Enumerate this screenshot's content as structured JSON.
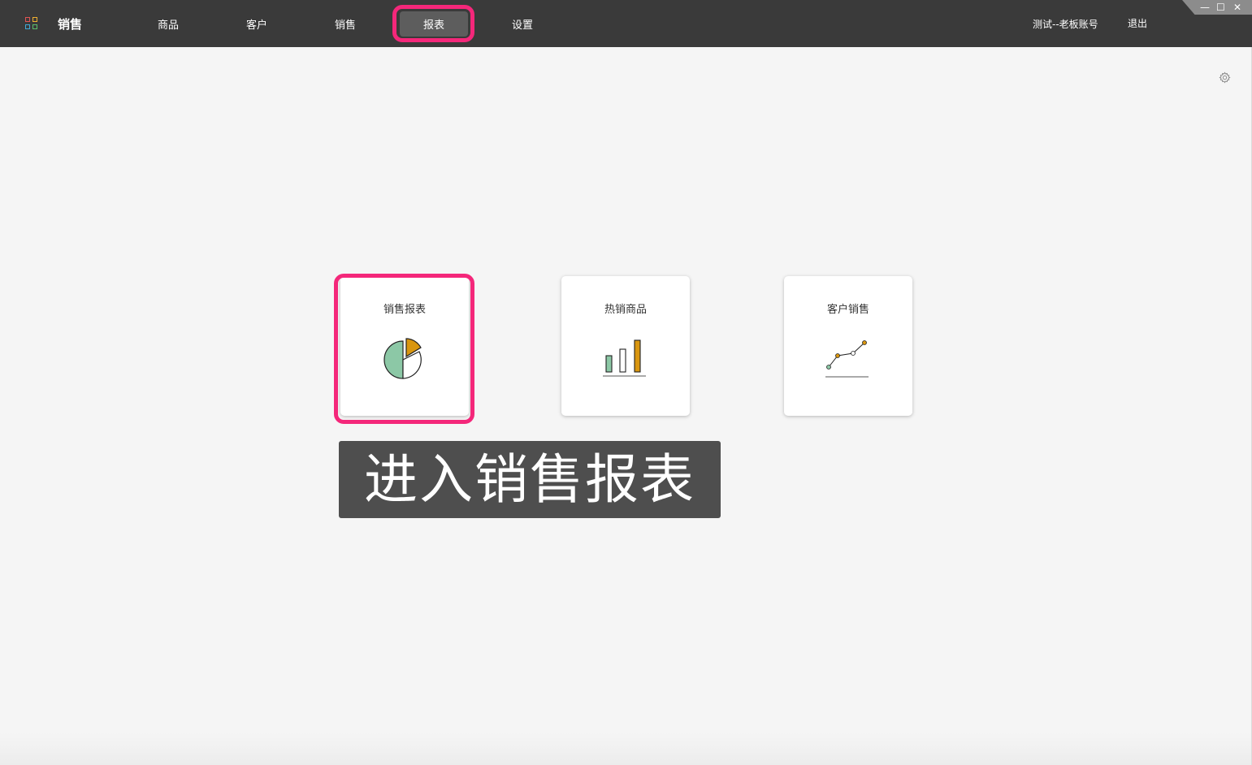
{
  "topbar": {
    "app_title": "销售",
    "nav": [
      {
        "label": "商品"
      },
      {
        "label": "客户"
      },
      {
        "label": "销售"
      },
      {
        "label": "报表",
        "active": true
      },
      {
        "label": "设置"
      }
    ],
    "account": "测试--老板账号",
    "logout": "退出",
    "window_controls": [
      "—",
      "☐",
      "✕"
    ]
  },
  "reports": {
    "cards": [
      {
        "label": "销售报表",
        "icon": "pie-chart-icon",
        "highlighted": true
      },
      {
        "label": "热销商品",
        "icon": "bar-chart-icon"
      },
      {
        "label": "客户销售",
        "icon": "line-chart-icon"
      }
    ]
  },
  "caption": "进入销售报表",
  "colors": {
    "topbar": "#3a3a3a",
    "highlight": "#f4277a",
    "icon_green": "#8cc8a6",
    "icon_gold": "#d9960f",
    "background": "#f5f5f5"
  }
}
